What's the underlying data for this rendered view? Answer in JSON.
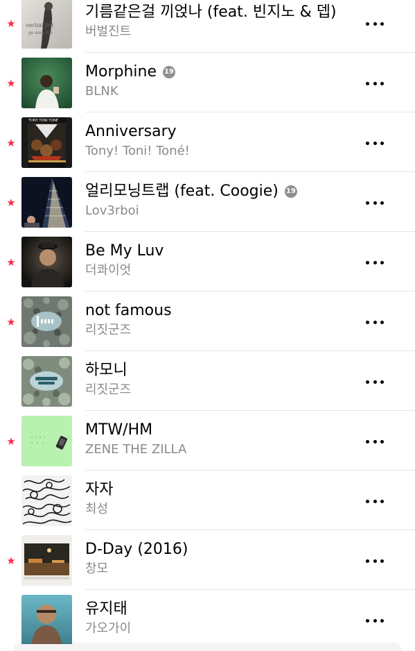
{
  "songs": [
    {
      "title": "기름같은걸 끼얹나 (feat. 빈지노 & 뎁)",
      "artist": "버벌진트",
      "favorite": true,
      "explicit": false,
      "art_text": "verbal jint",
      "art_subtext": "go easy 0.5"
    },
    {
      "title": "Morphine",
      "artist": "BLNK",
      "favorite": true,
      "explicit": true,
      "explicit_label": "19"
    },
    {
      "title": "Anniversary",
      "artist": "Tony! Toni! Toné!",
      "favorite": true,
      "explicit": false,
      "art_text": "TONY TONI TONE"
    },
    {
      "title": "얼리모닝트랩 (feat. Coogie)",
      "artist": "Lov3rboi",
      "favorite": true,
      "explicit": true,
      "explicit_label": "19"
    },
    {
      "title": "Be My Luv",
      "artist": "더콰이엇",
      "favorite": true,
      "explicit": false
    },
    {
      "title": "not famous",
      "artist": "리짓군즈",
      "favorite": true,
      "explicit": false
    },
    {
      "title": "하모니",
      "artist": "리짓군즈",
      "favorite": false,
      "explicit": false
    },
    {
      "title": "MTW/HM",
      "artist": "ZENE THE ZILLA",
      "favorite": true,
      "explicit": false
    },
    {
      "title": "자자",
      "artist": "최성",
      "favorite": false,
      "explicit": false
    },
    {
      "title": "D-Day (2016)",
      "artist": "창모",
      "favorite": true,
      "explicit": false
    },
    {
      "title": "유지태",
      "artist": "가오가이",
      "favorite": false,
      "explicit": false
    }
  ],
  "star_glyph": "★",
  "accent_color": "#fa2d48"
}
